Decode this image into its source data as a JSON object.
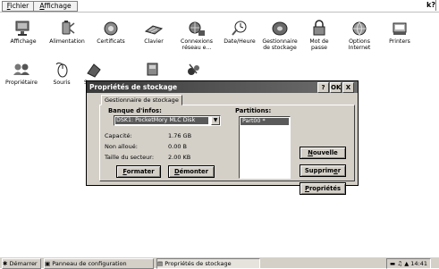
{
  "menubar": {
    "file_pre": "F",
    "file_post": "ichier",
    "view_pre": "A",
    "view_post": "ffichage",
    "help_label": "k?"
  },
  "control_panel": {
    "items": [
      {
        "label": "Affichage",
        "icon": "display-icon"
      },
      {
        "label": "Alimentation",
        "icon": "power-icon"
      },
      {
        "label": "Certificats",
        "icon": "certificates-icon"
      },
      {
        "label": "Clavier",
        "icon": "keyboard-icon"
      },
      {
        "label": "Connexions",
        "label2": "réseau e...",
        "icon": "network-icon"
      },
      {
        "label": "Date/Heure",
        "icon": "clock-icon"
      },
      {
        "label": "Gestionnaire",
        "label2": "de stockage",
        "icon": "storage-icon"
      },
      {
        "label": "Mot de",
        "label2": "passe",
        "icon": "password-icon"
      },
      {
        "label": "Options",
        "label2": "Internet",
        "icon": "internet-icon"
      },
      {
        "label": "Printers",
        "icon": "printer-icon"
      },
      {
        "label": "Propriétaire",
        "icon": "owner-icon"
      },
      {
        "label": "Souris",
        "icon": "mouse-icon"
      },
      {
        "label": "S",
        "icon": "system-icon"
      }
    ]
  },
  "dialog": {
    "title": "Propriétés de stockage",
    "help_btn": "?",
    "ok_btn": "OK",
    "close_btn": "X",
    "tab_label": "Gestionnaire de stockage",
    "info_label": "Banque d'infos:",
    "store_selected": "DSK1: PocketMory MLC Disk",
    "capacity_label": "Capacité:",
    "capacity_value": "1.76 GB",
    "unalloc_label": "Non alloué:",
    "unalloc_value": "0.00 B",
    "sector_label": "Taille du secteur:",
    "sector_value": "2.00 KB",
    "format_pre": "F",
    "format_post": "ormater",
    "dismount_pre": "D",
    "dismount_post": "émonter",
    "partitions_label": "Partitions:",
    "partition_item": "Part00 *",
    "new_pre": "N",
    "new_post": "ouvelle",
    "delete_pre": "Supprim",
    "delete_u": "e",
    "delete_post": "r",
    "props_pre": "P",
    "props_post": "ropriétés"
  },
  "taskbar": {
    "start": "Démarrer",
    "task1": "Panneau de configuration",
    "task2": "Propriétés de stockage",
    "time": "14:41"
  }
}
